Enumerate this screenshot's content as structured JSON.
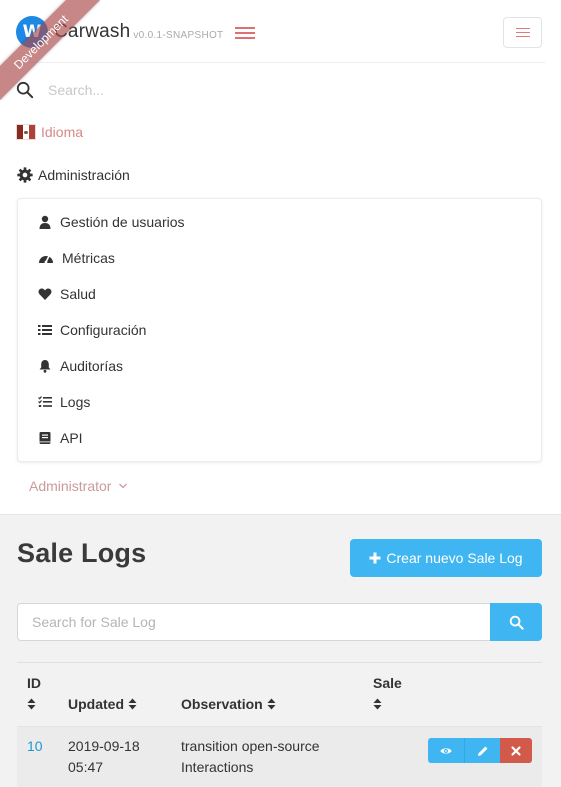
{
  "navbar": {
    "logo_letter": "W",
    "brand_title": "Carwash",
    "version": "v0.0.1-SNAPSHOT",
    "ribbon": "Development",
    "search_placeholder": "Search...",
    "language_label": "Idioma",
    "admin_label": "Administración",
    "admin_menu": [
      {
        "label": "Gestión de usuarios",
        "icon": "user-icon"
      },
      {
        "label": "Métricas",
        "icon": "tachometer-icon"
      },
      {
        "label": "Salud",
        "icon": "heart-icon"
      },
      {
        "label": "Configuración",
        "icon": "list-icon"
      },
      {
        "label": "Auditorías",
        "icon": "bell-icon"
      },
      {
        "label": "Logs",
        "icon": "tasks-icon"
      },
      {
        "label": "API",
        "icon": "book-icon"
      }
    ],
    "account_label": "Administrator"
  },
  "page": {
    "title": "Sale Logs",
    "create_button": "Crear nuevo Sale Log",
    "search_placeholder": "Search for Sale Log"
  },
  "table": {
    "headers": {
      "id": "ID",
      "updated": "Updated",
      "observation": "Observation",
      "sale": "Sale"
    },
    "rows": [
      {
        "id": "10",
        "updated_date": "2019-09-18",
        "updated_time": "05:47",
        "observation_line1": "transition open-source",
        "observation_line2": "Interactions",
        "sale": ""
      }
    ]
  },
  "colors": {
    "accent": "#3fb6f2",
    "danger": "#d15a4a",
    "link": "#2196d3",
    "ribbon": "#aa4646"
  }
}
